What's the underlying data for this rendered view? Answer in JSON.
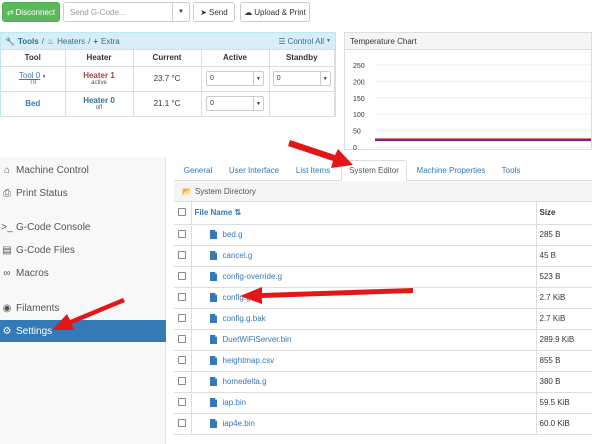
{
  "toolbar": {
    "disconnect_label": "Disconnect",
    "gcode_placeholder": "Send G-Code...",
    "send_label": "Send",
    "upload_label": "Upload & Print"
  },
  "tools_panel": {
    "crumb_tools": "Tools",
    "crumb_sep1": "/",
    "crumb_heaters": "Heaters",
    "crumb_sep2": "/",
    "crumb_extra": "Extra",
    "control_all": "Control All",
    "headers": [
      "Tool",
      "Heater",
      "Current",
      "Active",
      "Standby"
    ],
    "rows": [
      {
        "tool": "Tool 0",
        "tool_sub": "T0",
        "heater": "Heater 1",
        "heater_sub": "active",
        "current": "23.7 °C",
        "active": "0",
        "standby": "0"
      },
      {
        "tool": "Bed",
        "tool_sub": "",
        "heater": "Heater 0",
        "heater_sub": "off",
        "current": "21.1 °C",
        "active": "0",
        "standby": ""
      }
    ]
  },
  "temp_chart": {
    "title": "Temperature Chart",
    "chart_data": {
      "type": "line",
      "y_ticks": [
        "250",
        "200",
        "150",
        "100",
        "50",
        "0"
      ],
      "ylim": [
        0,
        250
      ],
      "series": [
        {
          "color": "#d9534f",
          "values": [
            23.7,
            23.7
          ]
        },
        {
          "color": "#5c2c8c",
          "values": [
            21.1,
            21.1
          ]
        }
      ]
    }
  },
  "sidebar": {
    "items": [
      {
        "label": "Machine Control",
        "icon": "home-icon"
      },
      {
        "label": "Print Status",
        "icon": "print-icon"
      },
      {
        "label": "G-Code Console",
        "icon": "console-icon"
      },
      {
        "label": "G-Code Files",
        "icon": "files-icon"
      },
      {
        "label": "Macros",
        "icon": "link-icon"
      },
      {
        "label": "Filaments",
        "icon": "dot-icon"
      },
      {
        "label": "Settings",
        "icon": "gear-icon",
        "active": true
      }
    ]
  },
  "tabs": [
    "General",
    "User Interface",
    "List Items",
    "System Editor",
    "Machine Properties",
    "Tools"
  ],
  "active_tab": "System Editor",
  "system_directory": "System Directory",
  "files": {
    "header_name": "File Name",
    "header_size": "Size",
    "rows": [
      {
        "name": "bed.g",
        "size": "285 B"
      },
      {
        "name": "cancel.g",
        "size": "45 B"
      },
      {
        "name": "config-override.g",
        "size": "523 B"
      },
      {
        "name": "config.g",
        "size": "2.7 KiB"
      },
      {
        "name": "config.g.bak",
        "size": "2.7 KiB"
      },
      {
        "name": "DuetWiFiServer.bin",
        "size": "289.9 KiB"
      },
      {
        "name": "heightmap.csv",
        "size": "855 B"
      },
      {
        "name": "homedelta.g",
        "size": "380 B"
      },
      {
        "name": "iap.bin",
        "size": "59.5 KiB"
      },
      {
        "name": "iap4e.bin",
        "size": "60.0 KiB"
      }
    ]
  },
  "colors": {
    "accent": "#337ab7",
    "success": "#5cb85c",
    "arrow": "#e21818"
  }
}
